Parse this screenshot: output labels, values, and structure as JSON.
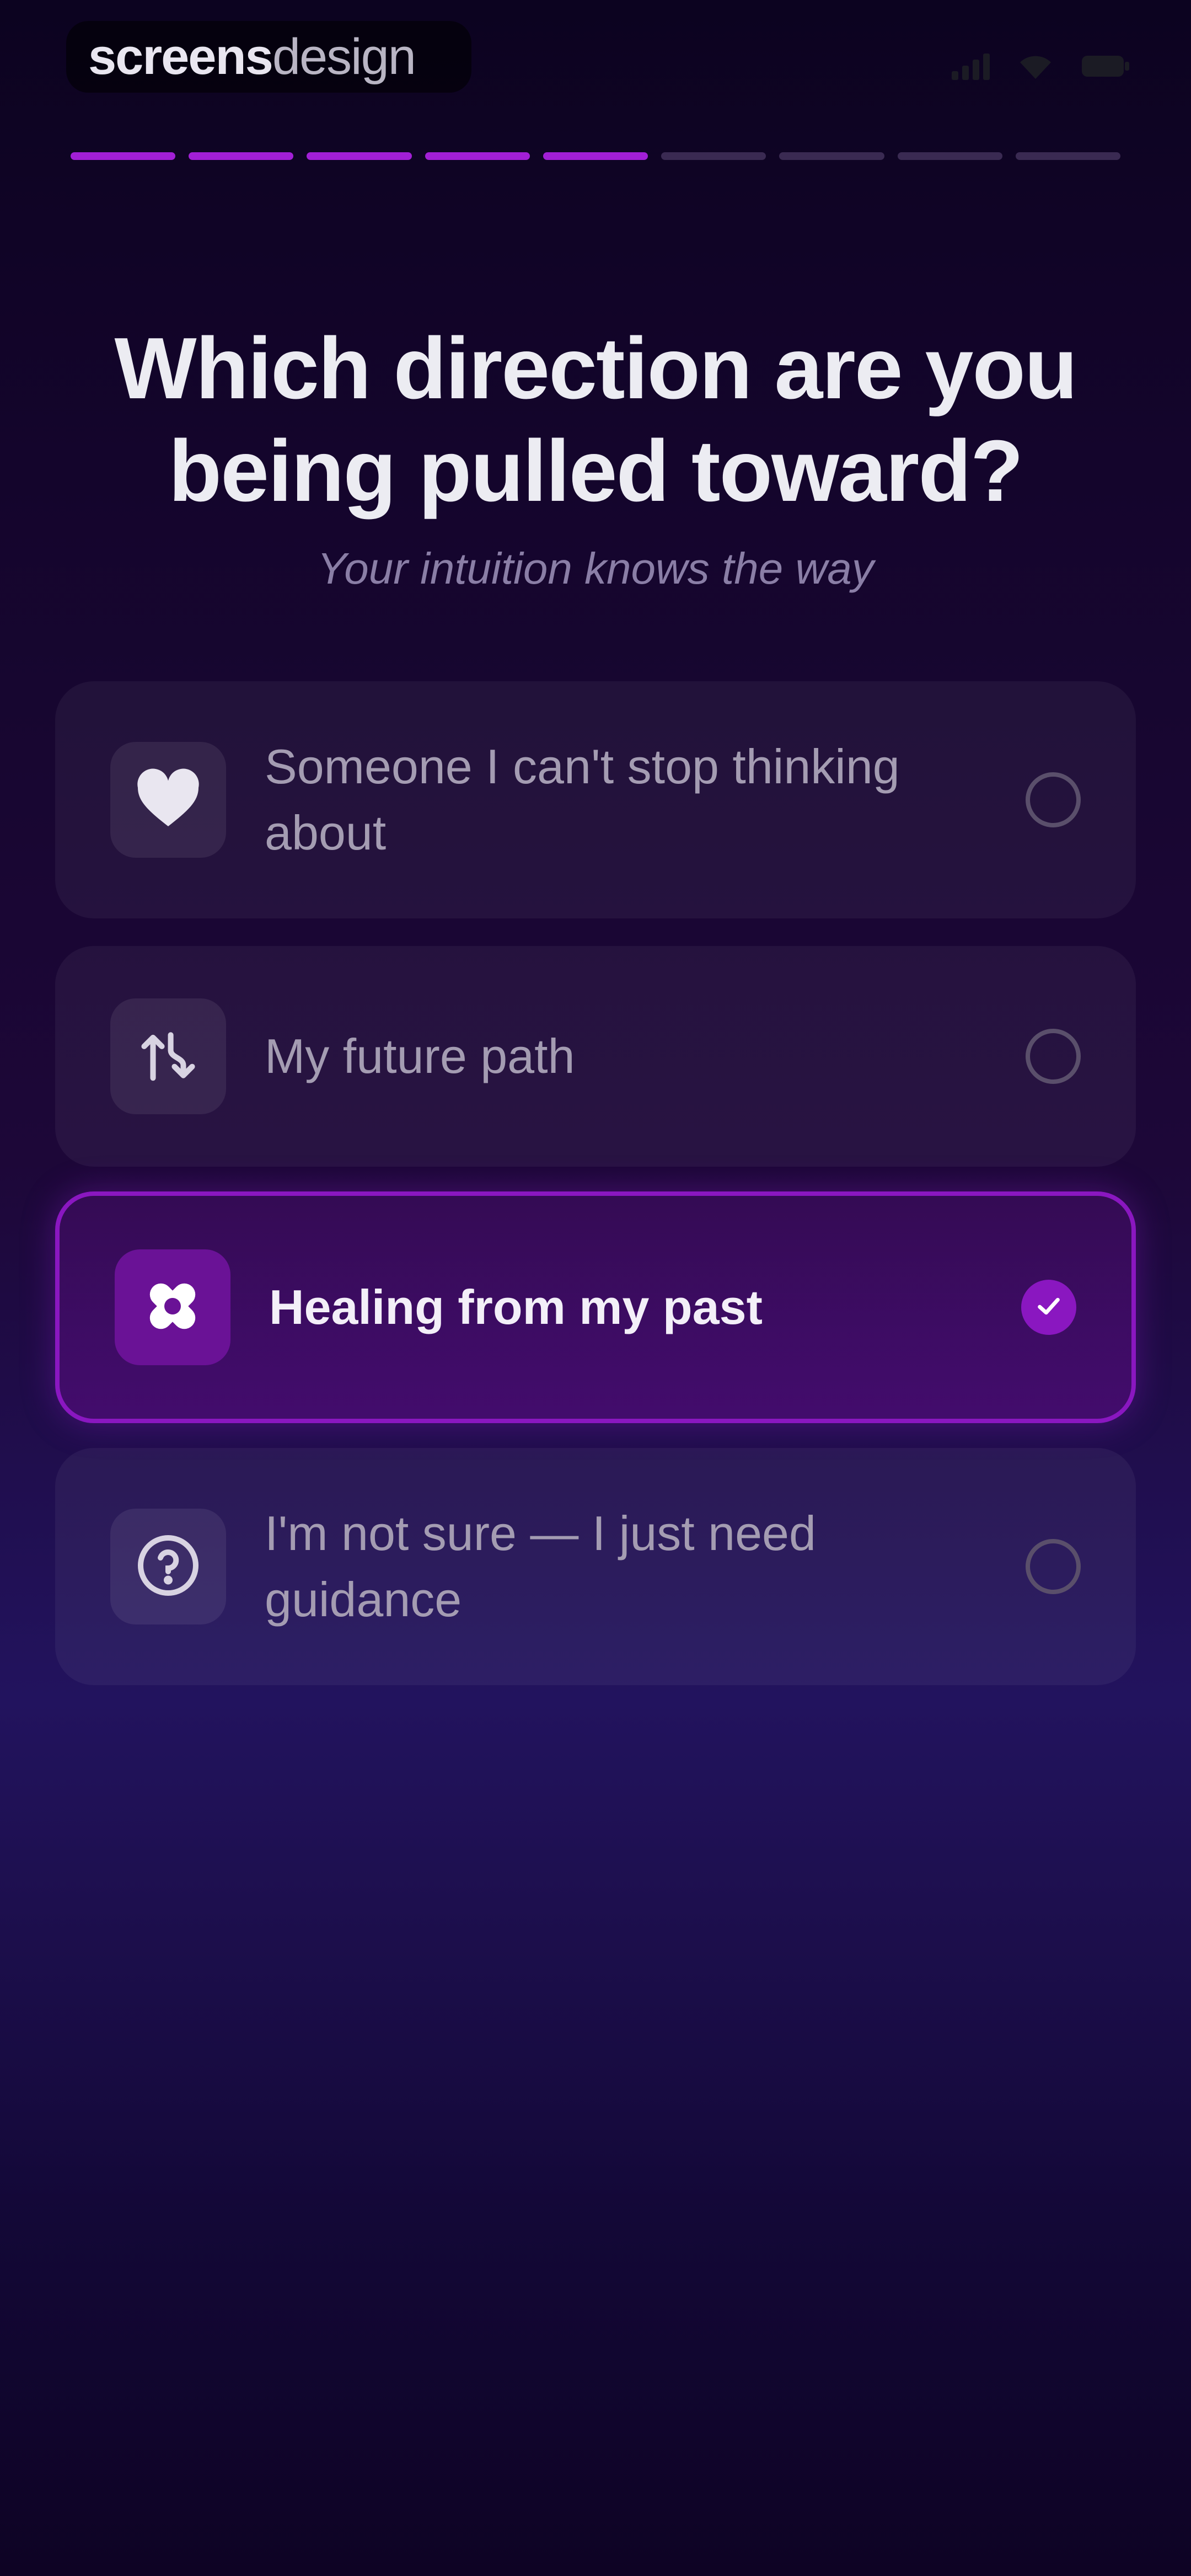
{
  "brand": {
    "part_a": "screens",
    "part_b": "design"
  },
  "progress": {
    "total_steps": 9,
    "completed_steps": 5
  },
  "question": {
    "title_line1": "Which direction are you",
    "title_line2": "being pulled toward?",
    "subtitle": "Your intuition knows the way"
  },
  "options": [
    {
      "label_line1": "Someone I can't stop thinking",
      "label_line2": "about",
      "icon": "heart-icon",
      "selected": false
    },
    {
      "label_line1": "My future path",
      "label_line2": "",
      "icon": "path-arrows-icon",
      "selected": false
    },
    {
      "label_line1": "Healing from my past",
      "label_line2": "",
      "icon": "bandage-icon",
      "selected": true
    },
    {
      "label_line1": "I'm not sure — I just need",
      "label_line2": "guidance",
      "icon": "question-circle-icon",
      "selected": false
    }
  ],
  "colors": {
    "accent": "#8a17c0",
    "progress_done": "#a21fd6",
    "progress_todo": "#3a2a52",
    "background_top": "#0c0320",
    "background_mid": "#22135e"
  }
}
